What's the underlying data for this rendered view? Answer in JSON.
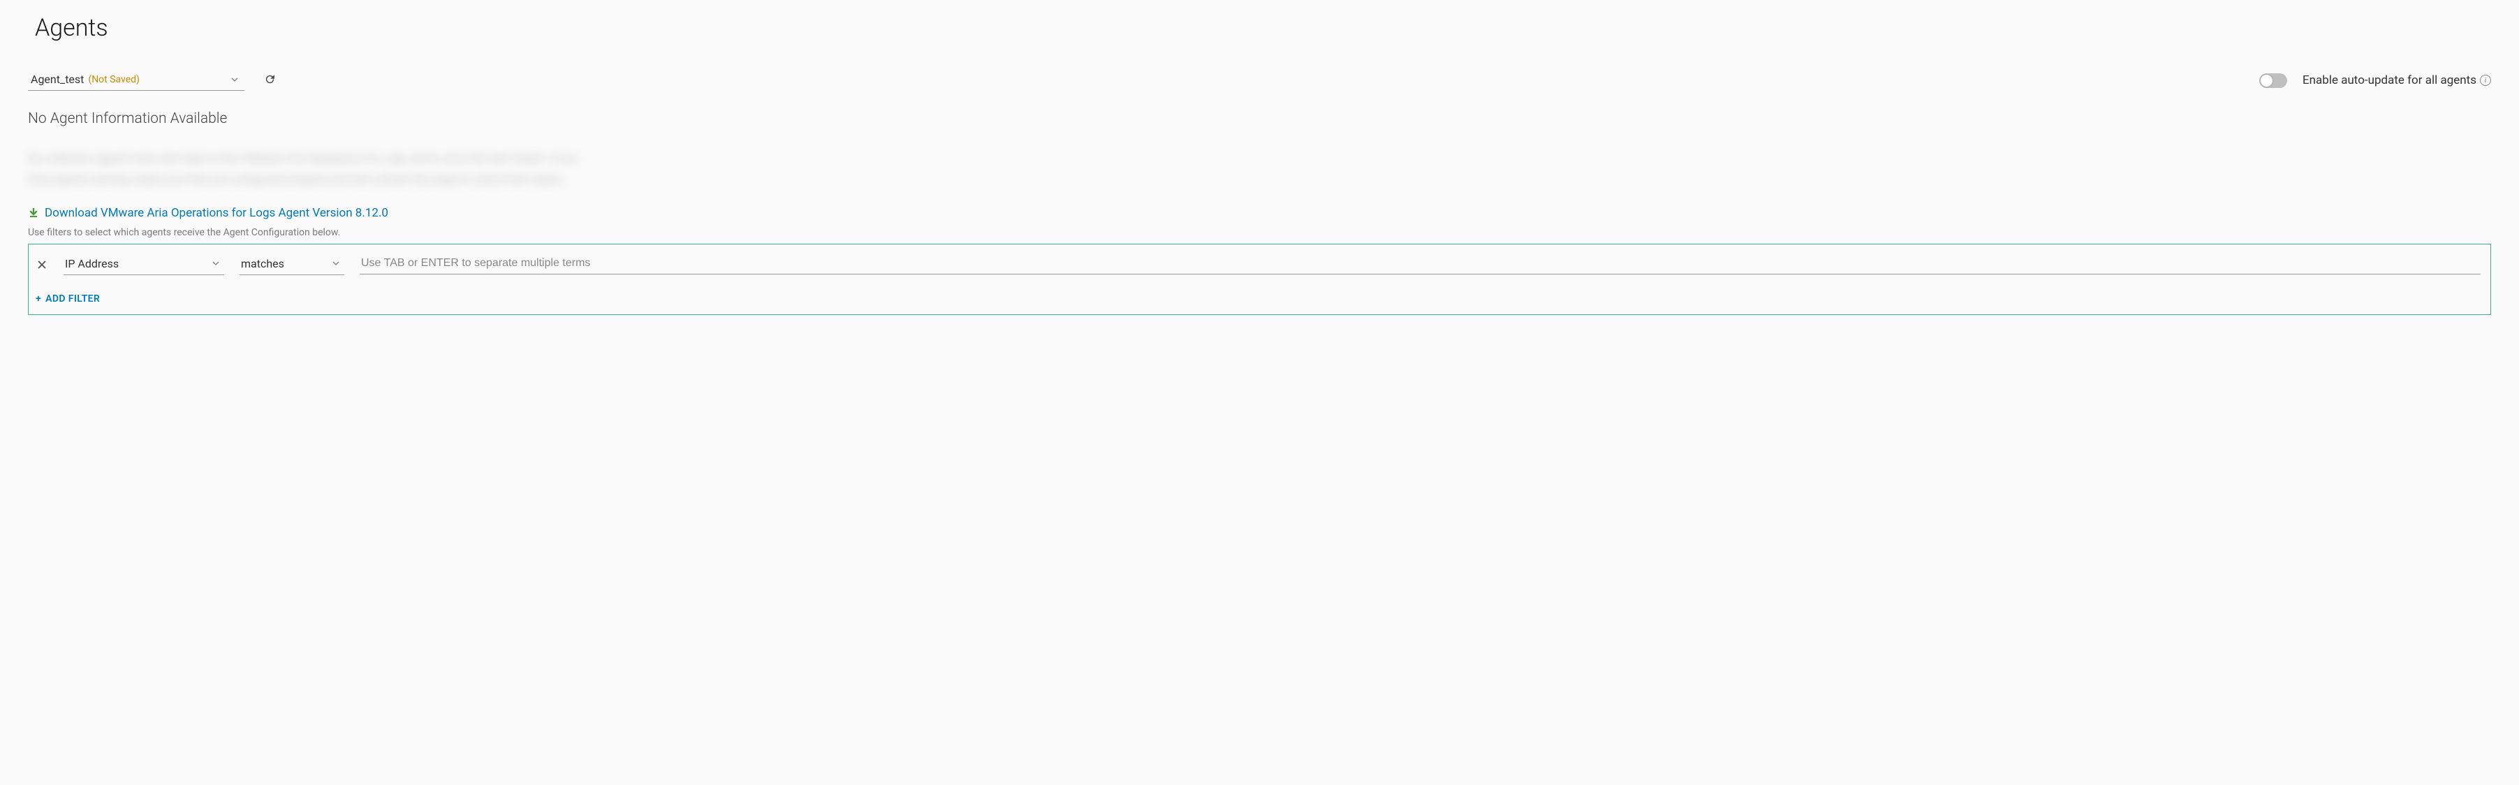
{
  "page": {
    "title": "Agents"
  },
  "agentSelect": {
    "name": "Agent_test",
    "status": "(Not Saved)"
  },
  "autoUpdate": {
    "label": "Enable auto-update for all agents",
    "enabled": false
  },
  "noInfo": "No Agent Information Available",
  "blurred": "No collection agents have sent data to this VMware Aria Operations for Logs server since the last restart. If you have agents running, make sure they are configured properly and then refresh this page to check their status.",
  "download": {
    "link": "Download VMware Aria Operations for Logs Agent Version 8.12.0"
  },
  "filterHint": "Use filters to select which agents receive the Agent Configuration below.",
  "filter": {
    "field": "IP Address",
    "operator": "matches",
    "valuePlaceholder": "Use TAB or ENTER to separate multiple terms",
    "addLabel": "Add Filter"
  }
}
